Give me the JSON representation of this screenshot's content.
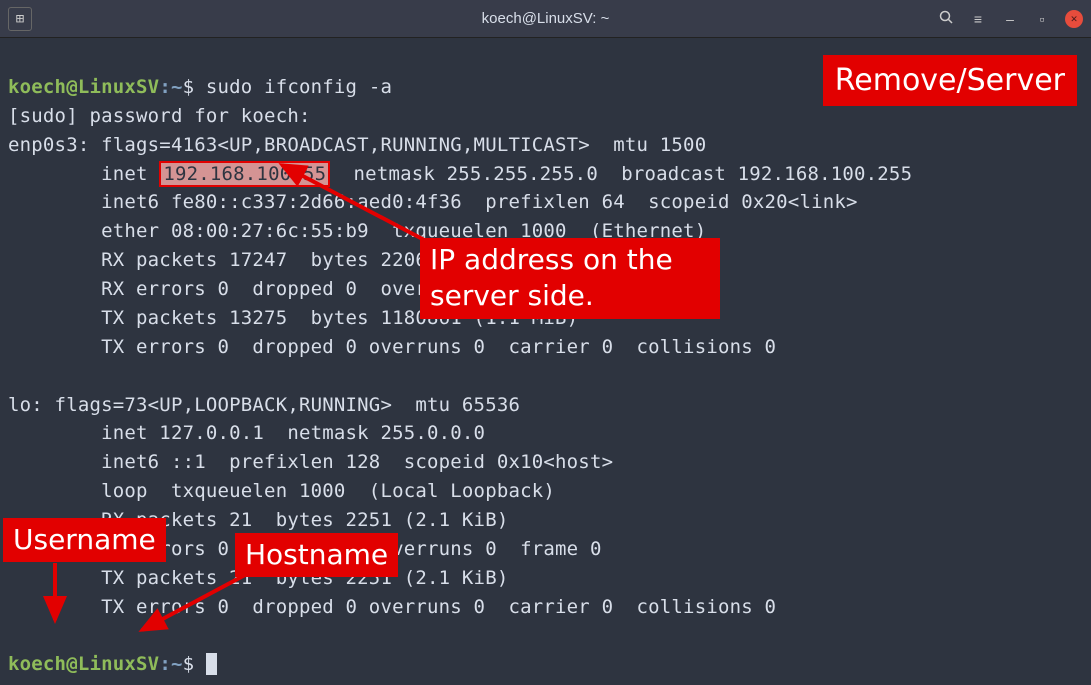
{
  "window": {
    "title": "koech@LinuxSV: ~"
  },
  "prompt": {
    "user": "koech",
    "at": "@",
    "host": "LinuxSV",
    "colon": ":",
    "path": "~",
    "dollar": "$"
  },
  "command": "sudo ifconfig -a",
  "lines": {
    "sudopw": "[sudo] password for koech:",
    "enp_flags": "enp0s3: flags=4163<UP,BROADCAST,RUNNING,MULTICAST>  mtu 1500",
    "inet_pre": "        inet ",
    "ip": "192.168.100.55",
    "inet_post": "  netmask 255.255.255.0  broadcast 192.168.100.255",
    "inet6": "        inet6 fe80::c337:2d66:aed0:4f36  prefixlen 64  scopeid 0x20<link>",
    "ether": "        ether 08:00:27:6c:55:b9  txqueuelen 1000  (Ethernet)",
    "rxp": "        RX packets 17247  bytes 22062127 (21.0 MiB)",
    "rxe": "        RX errors 0  dropped 0  overruns 0  frame 0",
    "txp": "        TX packets 13275  bytes 1180861 (1.1 MiB)",
    "txe": "        TX errors 0  dropped 0 overruns 0  carrier 0  collisions 0",
    "lo_flags": "lo: flags=73<UP,LOOPBACK,RUNNING>  mtu 65536",
    "lo_inet": "        inet 127.0.0.1  netmask 255.0.0.0",
    "lo_inet6": "        inet6 ::1  prefixlen 128  scopeid 0x10<host>",
    "lo_loop": "        loop  txqueuelen 1000  (Local Loopback)",
    "lo_rxp": "        RX packets 21  bytes 2251 (2.1 KiB)",
    "lo_rxe": "        RX errors 0  dropped 0  overruns 0  frame 0",
    "lo_txp": "        TX packets 21  bytes 2251 (2.1 KiB)",
    "lo_txe": "        TX errors 0  dropped 0 overruns 0  carrier 0  collisions 0"
  },
  "annotations": {
    "remove_server": "Remove/Server",
    "ip_label": "IP address on the server side.",
    "username": "Username",
    "hostname": "Hostname"
  },
  "icons": {
    "newtab": "⊞",
    "search": "🔍",
    "menu": "≡",
    "min": "–",
    "max": "▫",
    "close": "✕"
  }
}
